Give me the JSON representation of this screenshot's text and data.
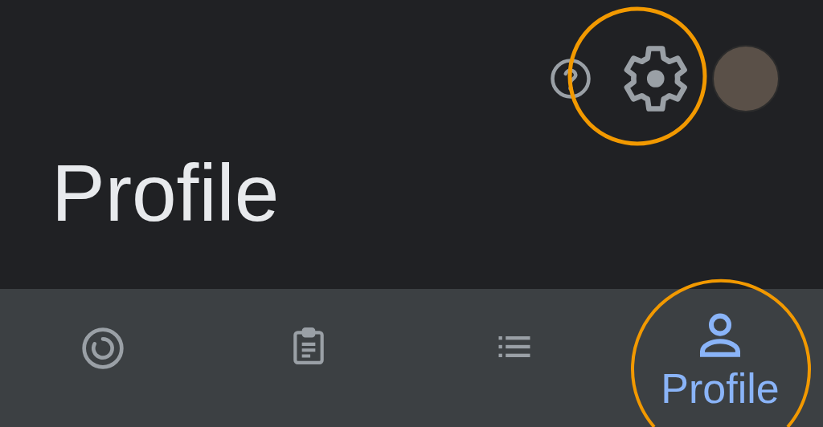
{
  "header": {
    "title": "Profile"
  },
  "bottom_nav": [
    {
      "selected": false
    },
    {
      "selected": false
    },
    {
      "selected": false
    },
    {
      "label": "Profile",
      "selected": true
    }
  ]
}
